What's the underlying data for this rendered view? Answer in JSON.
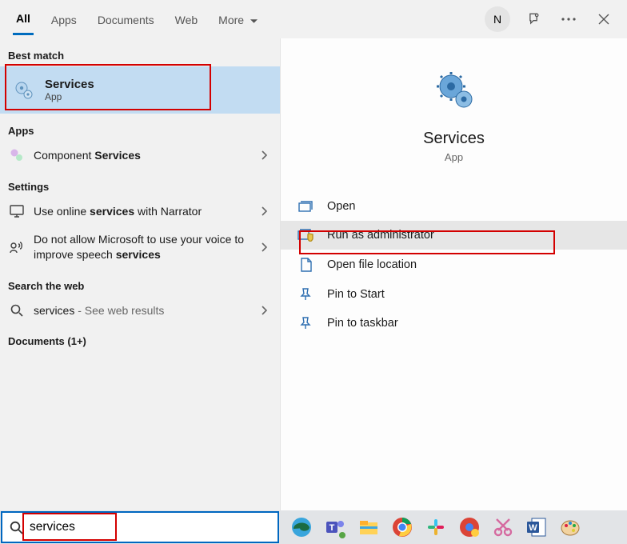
{
  "header": {
    "tabs": [
      "All",
      "Apps",
      "Documents",
      "Web",
      "More"
    ],
    "active_tab": 0,
    "avatar_initial": "N"
  },
  "left": {
    "best_match_label": "Best match",
    "best_match": {
      "title": "Services",
      "subtitle": "App"
    },
    "apps_label": "Apps",
    "apps": [
      {
        "prefix": "Component ",
        "bold": "Services"
      }
    ],
    "settings_label": "Settings",
    "settings": [
      {
        "pre": "Use online ",
        "bold": "services",
        "post": " with Narrator"
      },
      {
        "pre": "Do not allow Microsoft to use your voice to improve speech ",
        "bold": "services",
        "post": ""
      }
    ],
    "web_label": "Search the web",
    "web": {
      "term": "services",
      "suffix": " - See web results"
    },
    "documents_label": "Documents (1+)"
  },
  "right": {
    "title": "Services",
    "subtitle": "App",
    "actions": [
      {
        "label": "Open"
      },
      {
        "label": "Run as administrator",
        "selected": true
      },
      {
        "label": "Open file location"
      },
      {
        "label": "Pin to Start"
      },
      {
        "label": "Pin to taskbar"
      }
    ]
  },
  "taskbar": {
    "search_value": "services",
    "icons": [
      "edge-icon",
      "teams-icon",
      "explorer-icon",
      "chrome-icon",
      "slack-icon",
      "chrome-dev-icon",
      "snip-icon",
      "word-icon",
      "paint-icon"
    ]
  }
}
